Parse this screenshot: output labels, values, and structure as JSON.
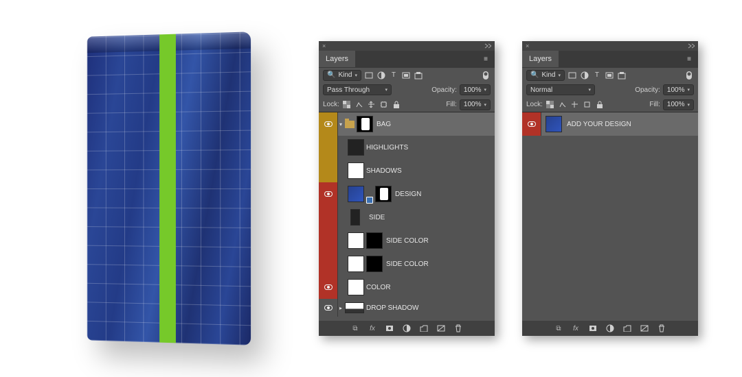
{
  "panel_title": "Layers",
  "filter": {
    "kind_label": "Kind"
  },
  "panelA": {
    "blend_mode": "Pass Through",
    "opacity_label": "Opacity:",
    "opacity_value": "100%",
    "lock_label": "Lock:",
    "fill_label": "Fill:",
    "fill_value": "100%",
    "layers": [
      {
        "name": "BAG",
        "vis": "amber",
        "eye": true,
        "selected": true,
        "folder": true,
        "mask": true,
        "exp": "▾"
      },
      {
        "name": "HIGHLIGHTS",
        "vis": "amber",
        "eye": false,
        "indent": 1,
        "thumb": "dark"
      },
      {
        "name": "SHADOWS",
        "vis": "amber",
        "eye": false,
        "indent": 1,
        "thumb": "white"
      },
      {
        "name": "DESIGN",
        "vis": "red",
        "eye": true,
        "indent": 1,
        "thumb": "blue",
        "mask": true,
        "smart": true
      },
      {
        "name": "SIDE",
        "vis": "empty-red",
        "eye": false,
        "indent": 1,
        "thumb": "dark",
        "narrow": true
      },
      {
        "name": "SIDE COLOR",
        "vis": "empty-red",
        "eye": false,
        "indent": 1,
        "thumb": "white",
        "mask": true
      },
      {
        "name": "SIDE COLOR",
        "vis": "empty-red",
        "eye": false,
        "indent": 1,
        "thumb": "white",
        "mask": true
      },
      {
        "name": "COLOR",
        "vis": "red",
        "eye": true,
        "indent": 1,
        "thumb": "white"
      }
    ],
    "drop_shadow": "DROP SHADOW"
  },
  "panelB": {
    "blend_mode": "Normal",
    "opacity_label": "Opacity:",
    "opacity_value": "100%",
    "lock_label": "Lock:",
    "fill_label": "Fill:",
    "fill_value": "100%",
    "layers": [
      {
        "name": "ADD YOUR DESIGN",
        "vis": "red",
        "eye": true,
        "selected": true,
        "thumb": "blue"
      }
    ]
  },
  "icons": {
    "menu": "≡",
    "link": "⊘",
    "fx": "fx",
    "mask": "◾",
    "adjust": "◑",
    "group": "▭",
    "new": "⊞",
    "trash": "🗑"
  }
}
